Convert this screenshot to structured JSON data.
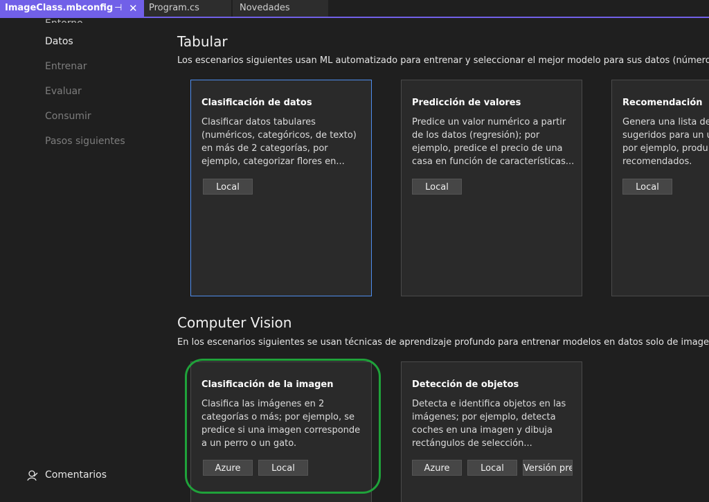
{
  "tabs": [
    {
      "label": "ImageClass.mbconfig",
      "pin": "⊣",
      "close": "✕"
    },
    {
      "label": "Program.cs"
    },
    {
      "label": "Novedades"
    }
  ],
  "sidebar": {
    "cut_item": "Entorno",
    "items": [
      {
        "label": "Datos",
        "state": "current"
      },
      {
        "label": "Entrenar",
        "state": "disabled"
      },
      {
        "label": "Evaluar",
        "state": "disabled"
      },
      {
        "label": "Consumir",
        "state": "disabled"
      },
      {
        "label": "Pasos siguientes",
        "state": "disabled"
      }
    ],
    "feedback_label": "Comentarios"
  },
  "tabular": {
    "title": "Tabular",
    "description": "Los escenarios siguientes usan ML automatizado para entrenar y seleccionar el mejor modelo para sus datos (números, t",
    "cards": [
      {
        "title": "Clasificación de datos",
        "lines": [
          "Clasificar datos tabulares",
          "(numéricos, categóricos, de texto)",
          "en más de 2 categorías, por",
          "ejemplo, categorizar flores en..."
        ],
        "buttons": [
          "Local"
        ]
      },
      {
        "title": "Predicción de valores",
        "lines": [
          "Predice un valor numérico a partir",
          "de los datos (regresión); por",
          "ejemplo, predice el precio de una",
          "casa en función de características..."
        ],
        "buttons": [
          "Local"
        ]
      },
      {
        "title": "Recomendación",
        "lines": [
          "Genera una lista de",
          "sugeridos para un u",
          "por ejemplo, produ",
          "recomendados."
        ],
        "buttons": [
          "Local"
        ]
      }
    ]
  },
  "vision": {
    "title": "Computer Vision",
    "description": "En los escenarios siguientes se usan técnicas de aprendizaje profundo para entrenar modelos en datos solo de imagen.",
    "cards": [
      {
        "title": "Clasificación de la imagen",
        "lines": [
          "Clasifica las imágenes en 2",
          "categorías o más; por ejemplo, se",
          "predice si una imagen corresponde",
          "a un perro o un gato."
        ],
        "buttons": [
          "Azure",
          "Local"
        ]
      },
      {
        "title": "Detección de objetos",
        "lines": [
          "Detecta e identifica objetos en las",
          "imágenes; por ejemplo, detecta",
          "coches en una imagen y dibuja",
          "rectángulos de selección..."
        ],
        "buttons": [
          "Azure",
          "Local",
          "Versión pre"
        ]
      }
    ]
  },
  "colors": {
    "accent": "#7160e8",
    "selected_border": "#4f8ff0",
    "highlight_ring": "#1fa23a",
    "background": "#1f1f1f",
    "card_background": "#2a2a2a"
  }
}
